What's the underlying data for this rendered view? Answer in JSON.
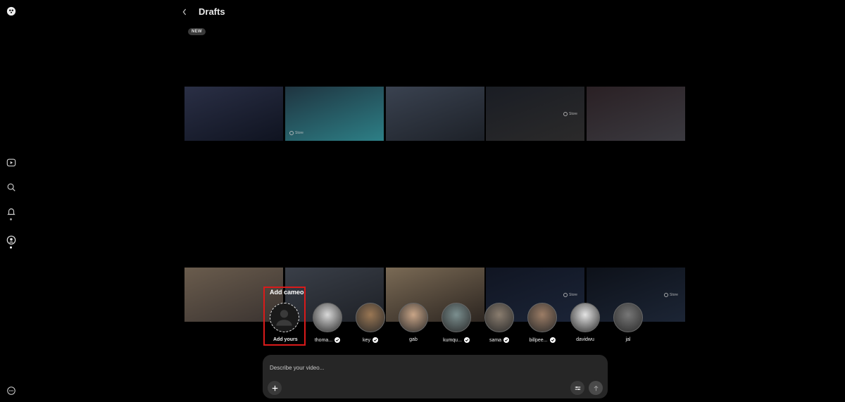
{
  "header": {
    "title": "Drafts",
    "badge": "NEW"
  },
  "sidebar": {
    "items": [
      {
        "name": "logo-icon"
      },
      {
        "name": "play-icon"
      },
      {
        "name": "search-icon"
      },
      {
        "name": "bell-icon"
      },
      {
        "name": "profile-icon"
      },
      {
        "name": "more-icon"
      }
    ]
  },
  "grid": {
    "row1": [
      {
        "label": "",
        "colors": [
          "#2a2f45",
          "#0f1320"
        ]
      },
      {
        "label": "Store",
        "colors": [
          "#1f3440",
          "#2d7f86"
        ]
      },
      {
        "label": "",
        "colors": [
          "#3a4250",
          "#1d2128"
        ]
      },
      {
        "label": "Store",
        "colors": [
          "#1a1d24",
          "#2b2a2a"
        ]
      },
      {
        "label": "",
        "colors": [
          "#2a2024",
          "#3b3a40"
        ]
      }
    ],
    "row2": [
      {
        "label": "",
        "colors": [
          "#6a5c4d",
          "#3a3330"
        ]
      },
      {
        "label": "",
        "colors": [
          "#3a3f48",
          "#1d2026"
        ]
      },
      {
        "label": "",
        "colors": [
          "#7a6a55",
          "#2c2520"
        ]
      },
      {
        "label": "Store",
        "colors": [
          "#101522",
          "#1b2437"
        ]
      },
      {
        "label": "Store",
        "colors": [
          "#0d1119",
          "#1c2535"
        ]
      }
    ]
  },
  "cameo": {
    "heading": "Add cameo",
    "add_label": "Add yours",
    "people": [
      {
        "name": "thoma...",
        "verified": true,
        "color": "#d9d9d9"
      },
      {
        "name": "key",
        "verified": true,
        "color": "#9a7754"
      },
      {
        "name": "gab",
        "verified": false,
        "color": "#c9a587"
      },
      {
        "name": "kumqu...",
        "verified": true,
        "color": "#7b8f8f"
      },
      {
        "name": "sama",
        "verified": true,
        "color": "#8a7d6f"
      },
      {
        "name": "billpee...",
        "verified": true,
        "color": "#9c7d66"
      },
      {
        "name": "davidwu",
        "verified": false,
        "color": "#e4e4e4"
      },
      {
        "name": "jal",
        "verified": false,
        "color": "#777777"
      }
    ]
  },
  "composer": {
    "placeholder": "Describe your video..."
  }
}
